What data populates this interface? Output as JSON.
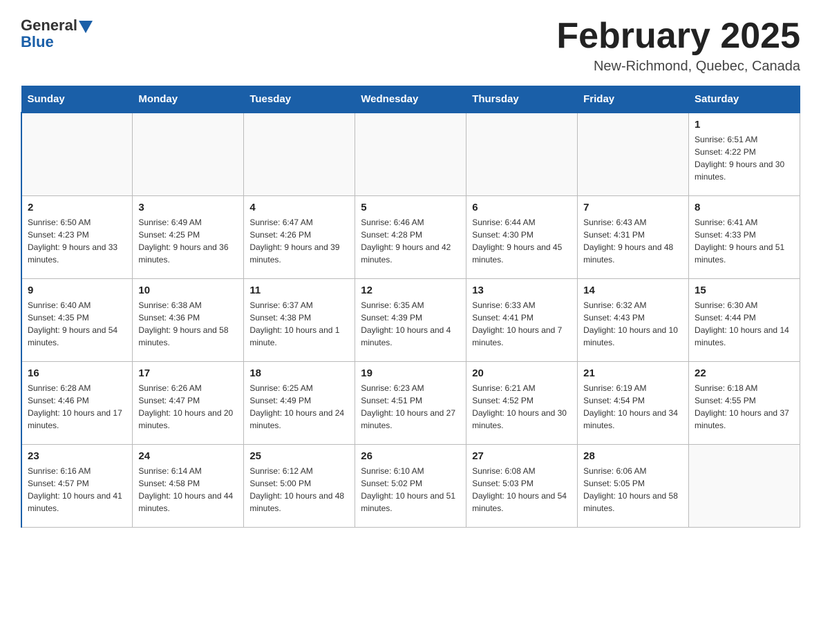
{
  "header": {
    "logo_general": "General",
    "logo_blue": "Blue",
    "title": "February 2025",
    "subtitle": "New-Richmond, Quebec, Canada"
  },
  "weekdays": [
    "Sunday",
    "Monday",
    "Tuesday",
    "Wednesday",
    "Thursday",
    "Friday",
    "Saturday"
  ],
  "weeks": [
    [
      {
        "day": "",
        "info": ""
      },
      {
        "day": "",
        "info": ""
      },
      {
        "day": "",
        "info": ""
      },
      {
        "day": "",
        "info": ""
      },
      {
        "day": "",
        "info": ""
      },
      {
        "day": "",
        "info": ""
      },
      {
        "day": "1",
        "info": "Sunrise: 6:51 AM\nSunset: 4:22 PM\nDaylight: 9 hours and 30 minutes."
      }
    ],
    [
      {
        "day": "2",
        "info": "Sunrise: 6:50 AM\nSunset: 4:23 PM\nDaylight: 9 hours and 33 minutes."
      },
      {
        "day": "3",
        "info": "Sunrise: 6:49 AM\nSunset: 4:25 PM\nDaylight: 9 hours and 36 minutes."
      },
      {
        "day": "4",
        "info": "Sunrise: 6:47 AM\nSunset: 4:26 PM\nDaylight: 9 hours and 39 minutes."
      },
      {
        "day": "5",
        "info": "Sunrise: 6:46 AM\nSunset: 4:28 PM\nDaylight: 9 hours and 42 minutes."
      },
      {
        "day": "6",
        "info": "Sunrise: 6:44 AM\nSunset: 4:30 PM\nDaylight: 9 hours and 45 minutes."
      },
      {
        "day": "7",
        "info": "Sunrise: 6:43 AM\nSunset: 4:31 PM\nDaylight: 9 hours and 48 minutes."
      },
      {
        "day": "8",
        "info": "Sunrise: 6:41 AM\nSunset: 4:33 PM\nDaylight: 9 hours and 51 minutes."
      }
    ],
    [
      {
        "day": "9",
        "info": "Sunrise: 6:40 AM\nSunset: 4:35 PM\nDaylight: 9 hours and 54 minutes."
      },
      {
        "day": "10",
        "info": "Sunrise: 6:38 AM\nSunset: 4:36 PM\nDaylight: 9 hours and 58 minutes."
      },
      {
        "day": "11",
        "info": "Sunrise: 6:37 AM\nSunset: 4:38 PM\nDaylight: 10 hours and 1 minute."
      },
      {
        "day": "12",
        "info": "Sunrise: 6:35 AM\nSunset: 4:39 PM\nDaylight: 10 hours and 4 minutes."
      },
      {
        "day": "13",
        "info": "Sunrise: 6:33 AM\nSunset: 4:41 PM\nDaylight: 10 hours and 7 minutes."
      },
      {
        "day": "14",
        "info": "Sunrise: 6:32 AM\nSunset: 4:43 PM\nDaylight: 10 hours and 10 minutes."
      },
      {
        "day": "15",
        "info": "Sunrise: 6:30 AM\nSunset: 4:44 PM\nDaylight: 10 hours and 14 minutes."
      }
    ],
    [
      {
        "day": "16",
        "info": "Sunrise: 6:28 AM\nSunset: 4:46 PM\nDaylight: 10 hours and 17 minutes."
      },
      {
        "day": "17",
        "info": "Sunrise: 6:26 AM\nSunset: 4:47 PM\nDaylight: 10 hours and 20 minutes."
      },
      {
        "day": "18",
        "info": "Sunrise: 6:25 AM\nSunset: 4:49 PM\nDaylight: 10 hours and 24 minutes."
      },
      {
        "day": "19",
        "info": "Sunrise: 6:23 AM\nSunset: 4:51 PM\nDaylight: 10 hours and 27 minutes."
      },
      {
        "day": "20",
        "info": "Sunrise: 6:21 AM\nSunset: 4:52 PM\nDaylight: 10 hours and 30 minutes."
      },
      {
        "day": "21",
        "info": "Sunrise: 6:19 AM\nSunset: 4:54 PM\nDaylight: 10 hours and 34 minutes."
      },
      {
        "day": "22",
        "info": "Sunrise: 6:18 AM\nSunset: 4:55 PM\nDaylight: 10 hours and 37 minutes."
      }
    ],
    [
      {
        "day": "23",
        "info": "Sunrise: 6:16 AM\nSunset: 4:57 PM\nDaylight: 10 hours and 41 minutes."
      },
      {
        "day": "24",
        "info": "Sunrise: 6:14 AM\nSunset: 4:58 PM\nDaylight: 10 hours and 44 minutes."
      },
      {
        "day": "25",
        "info": "Sunrise: 6:12 AM\nSunset: 5:00 PM\nDaylight: 10 hours and 48 minutes."
      },
      {
        "day": "26",
        "info": "Sunrise: 6:10 AM\nSunset: 5:02 PM\nDaylight: 10 hours and 51 minutes."
      },
      {
        "day": "27",
        "info": "Sunrise: 6:08 AM\nSunset: 5:03 PM\nDaylight: 10 hours and 54 minutes."
      },
      {
        "day": "28",
        "info": "Sunrise: 6:06 AM\nSunset: 5:05 PM\nDaylight: 10 hours and 58 minutes."
      },
      {
        "day": "",
        "info": ""
      }
    ]
  ]
}
